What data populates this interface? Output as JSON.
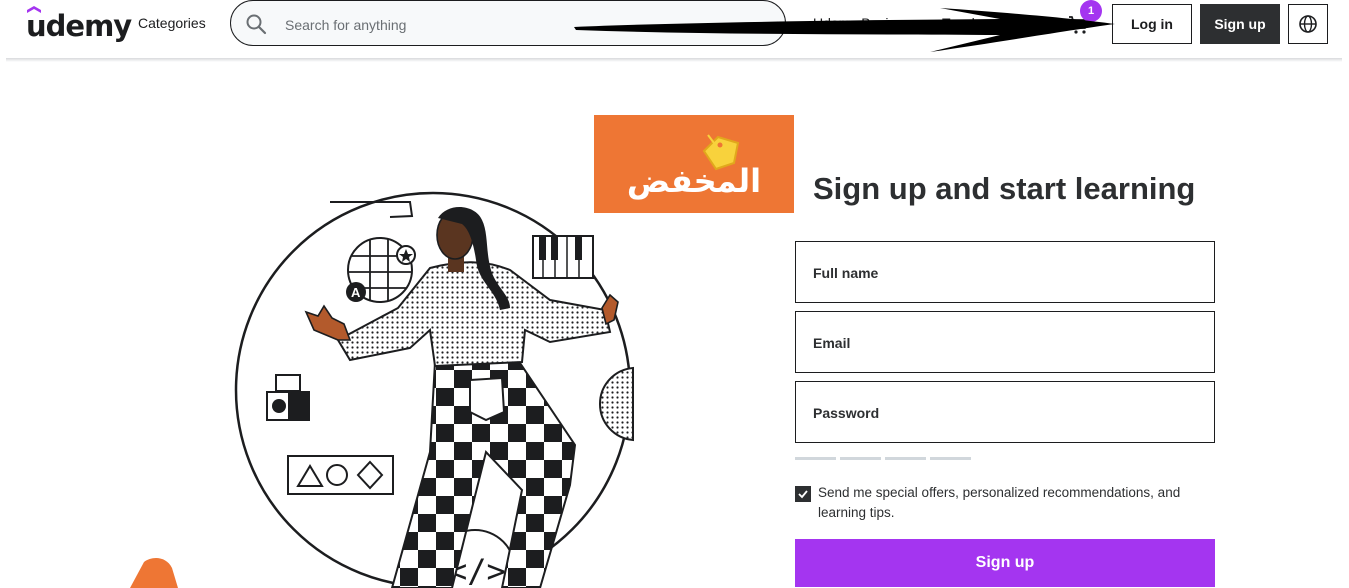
{
  "header": {
    "logo_text": "udemy",
    "categories_label": "Categories",
    "search": {
      "placeholder": "Search for anything"
    },
    "nav": {
      "business_label": "Udemy Business",
      "teach_label": "Teach on Udemy"
    },
    "cart_badge": "1",
    "login_label": "Log in",
    "signup_label": "Sign up",
    "brand_color": "#a435f0"
  },
  "promo": {
    "text": "المخفض",
    "background": "#ee7634"
  },
  "form": {
    "title": "Sign up and start learning",
    "fields": [
      {
        "label": "Full name"
      },
      {
        "label": "Email"
      },
      {
        "label": "Password"
      }
    ],
    "consent_text": "Send me special offers, personalized recommendations, and learning tips.",
    "consent_checked": true,
    "submit_label": "Sign up",
    "submit_color": "#a435f0"
  },
  "icons": [
    "search-icon",
    "cart-icon",
    "globe-icon",
    "checkmark-icon",
    "price-tag-icon"
  ]
}
